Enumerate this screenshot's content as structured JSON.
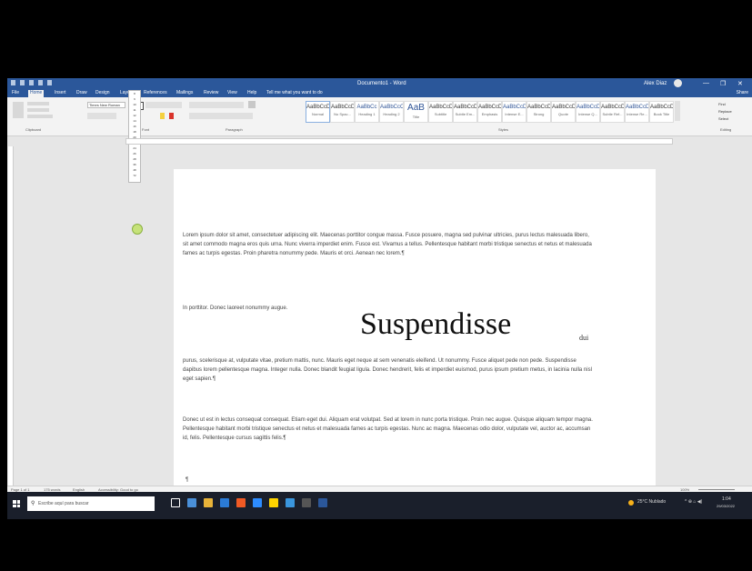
{
  "window": {
    "title": "Documento1 - Word",
    "user_name": "Alex Diaz",
    "minimize_glyph": "—",
    "restore_glyph": "❐",
    "close_glyph": "✕"
  },
  "tabs": [
    {
      "label": "File"
    },
    {
      "label": "Home",
      "active": true
    },
    {
      "label": "Insert"
    },
    {
      "label": "Draw"
    },
    {
      "label": "Design"
    },
    {
      "label": "Layout"
    },
    {
      "label": "References"
    },
    {
      "label": "Mailings"
    },
    {
      "label": "Review"
    },
    {
      "label": "View"
    },
    {
      "label": "Help"
    },
    {
      "label": "Tell me what you want to do"
    }
  ],
  "share_label": "Share",
  "ribbon": {
    "font_name": "Times New Roman",
    "font_size": "72",
    "size_options": [
      "8",
      "9",
      "10",
      "11",
      "12",
      "14",
      "16",
      "18",
      "20",
      "22",
      "24",
      "26",
      "28",
      "36",
      "48",
      "72"
    ],
    "groups": [
      "Clipboard",
      "Font",
      "Paragraph",
      "Styles",
      "Editing"
    ],
    "styles": [
      {
        "sample": "AaBbCcDc",
        "name": "Normal"
      },
      {
        "sample": "AaBbCcDc",
        "name": "No Spac..."
      },
      {
        "sample": "AaBbCc",
        "name": "Heading 1"
      },
      {
        "sample": "AaBbCcC",
        "name": "Heading 2"
      },
      {
        "sample": "AaB",
        "name": "Title"
      },
      {
        "sample": "AaBbCcD",
        "name": "Subtitle"
      },
      {
        "sample": "AaBbCcDd",
        "name": "Subtle Em..."
      },
      {
        "sample": "AaBbCcDd",
        "name": "Emphasis"
      },
      {
        "sample": "AaBbCcDd",
        "name": "Intense E..."
      },
      {
        "sample": "AaBbCcDd",
        "name": "Strong"
      },
      {
        "sample": "AaBbCcDd",
        "name": "Quote"
      },
      {
        "sample": "AaBbCcDd",
        "name": "Intense Q..."
      },
      {
        "sample": "AaBbCcDd",
        "name": "Subtle Ref..."
      },
      {
        "sample": "AaBbCcDd",
        "name": "Intense Re..."
      },
      {
        "sample": "AaBbCcDd",
        "name": "Book Title"
      }
    ],
    "editing": [
      "Find",
      "Replace",
      "Select"
    ]
  },
  "document": {
    "p1": "Lorem ipsum dolor sit amet, consectetuer adipiscing elit. Maecenas porttitor congue massa. Fusce posuere, magna sed pulvinar ultricies, purus lectus malesuada libero, sit amet commodo magna eros quis urna. Nunc viverra imperdiet enim. Fusce est. Vivamus a tellus. Pellentesque habitant morbi tristique senectus et netus et malesuada fames ac turpis egestas. Proin pharetra nonummy pede. Mauris et orci. Aenean nec lorem.¶",
    "p2_lead": "In porttitor. Donec laoreet nonummy augue.",
    "drop_word": "Suspendisse",
    "drop_tail": "dui",
    "p2_rest": "purus, scelerisque at, vulputate vitae, pretium mattis, nunc. Mauris eget neque at sem venenatis eleifend. Ut nonummy. Fusce aliquet pede non pede. Suspendisse dapibus lorem pellentesque magna. Integer nulla. Donec blandit feugiat ligula. Donec hendrerit, felis et imperdiet euismod, purus ipsum pretium metus, in lacinia nulla nisl eget sapien.¶",
    "p3": "Donec ut est in lectus consequat consequat. Etiam eget dui. Aliquam erat volutpat. Sed at lorem in nunc porta tristique. Proin nec augue. Quisque aliquam tempor magna. Pellentesque habitant morbi tristique senectus et netus et malesuada fames ac turpis egestas. Nunc ac magna. Maecenas odio dolor, vulputate vel, auctor ac, accumsan id, felis. Pellentesque cursus sagittis felis.¶",
    "pilcrow": "¶"
  },
  "status": {
    "page": "Page 1 of 1",
    "words": "175 words",
    "language": "English",
    "accessibility": "Accessibility: Good to go",
    "zoom": "100%"
  },
  "taskbar": {
    "search_placeholder": "Escribe aquí para buscar",
    "weather": "25°C Nublado",
    "time": "1:04",
    "date": "29/03/2022",
    "icon_colors": [
      "#ffffff",
      "#4a90d9",
      "#e8b339",
      "#2b7bd6",
      "#f15a24",
      "#2d8cff",
      "#ffd400",
      "#3a96dd",
      "#555555",
      "#2b579a"
    ]
  }
}
